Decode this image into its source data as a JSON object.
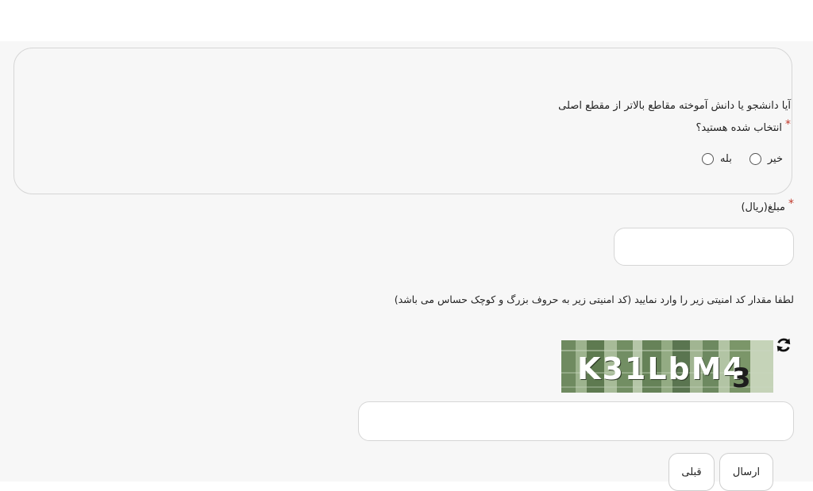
{
  "question": {
    "line1": "آیا دانشجو یا دانش آموخته مقاطع بالاتر از مقطع اصلی",
    "line2": "انتخاب شده هستید؟",
    "required_mark": "*",
    "options": [
      {
        "label": "خیر"
      },
      {
        "label": "بله"
      }
    ]
  },
  "amount": {
    "label": "مبلغ(ریال)",
    "required_mark": "*",
    "value": ""
  },
  "captcha": {
    "instructions": "لطفا مقدار کد امنیتی زیر را وارد نمایید (کد امنیتی زیر به حروف بزرگ و کوچک حساس می باشد)",
    "image_text": "K31LbM4",
    "image_text_tail": "3",
    "refresh_icon": "refresh-icon",
    "input_value": ""
  },
  "buttons": {
    "submit": "ارسال",
    "previous": "قبلی"
  }
}
